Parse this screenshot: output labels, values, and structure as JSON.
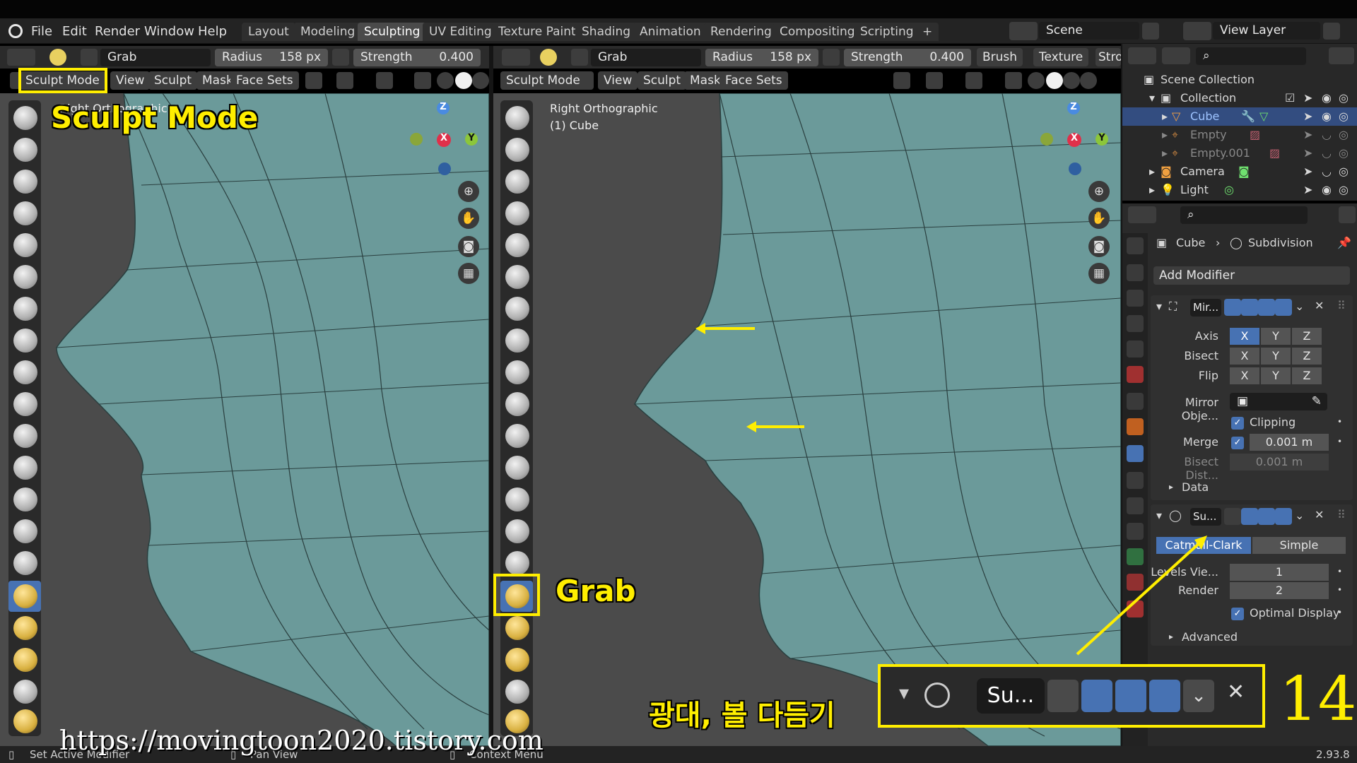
{
  "menu": {
    "file": "File",
    "edit": "Edit",
    "render": "Render",
    "window": "Window",
    "help": "Help"
  },
  "workspaces": [
    "Layout",
    "Modeling",
    "Sculpting",
    "UV Editing",
    "Texture Paint",
    "Shading",
    "Animation",
    "Rendering",
    "Compositing",
    "Scripting"
  ],
  "workspace_add": "+",
  "scene": "Scene",
  "view_layer": "View Layer",
  "left_view": {
    "brush_name": "Grab",
    "radius_label": "Radius",
    "radius_value": "158 px",
    "strength_label": "Strength",
    "strength_value": "0.400",
    "mode": "Sculpt Mode",
    "menus": [
      "View",
      "Sculpt",
      "Mask",
      "Face Sets"
    ],
    "view_title": "Right Orthographic"
  },
  "right_view": {
    "brush_name": "Grab",
    "radius_label": "Radius",
    "radius_value": "158 px",
    "strength_label": "Strength",
    "strength_value": "0.400",
    "brush_menu": "Brush",
    "texture_menu": "Texture",
    "stroke_menu": "Stro",
    "mode": "Sculpt Mode",
    "menus": [
      "View",
      "Sculpt",
      "Mask",
      "Face Sets"
    ],
    "view_title": "Right Orthographic",
    "view_object": "(1) Cube"
  },
  "gizmo": {
    "z": "Z",
    "x": "X",
    "y": "Y"
  },
  "outliner": {
    "scene_collection": "Scene Collection",
    "collection": "Collection",
    "items": [
      "Cube",
      "Empty",
      "Empty.001",
      "Camera",
      "Light"
    ]
  },
  "properties": {
    "object": "Cube",
    "modifier_name": "Subdivision",
    "add_modifier": "Add Modifier",
    "mirror": {
      "name": "Mir...",
      "axis_label": "Axis",
      "bisect_label": "Bisect",
      "flip_label": "Flip",
      "x": "X",
      "y": "Y",
      "z": "Z",
      "mirror_object_label": "Mirror Obje...",
      "clipping_label": "Clipping",
      "merge_label": "Merge",
      "merge_value": "0.001 m",
      "bisect_dist_label": "Bisect Dist...",
      "bisect_dist_value": "0.001 m",
      "data_label": "Data"
    },
    "subdiv": {
      "name": "Su...",
      "catmull": "Catmull-Clark",
      "simple": "Simple",
      "levels_label": "Levels Vie...",
      "levels_value": "1",
      "render_label": "Render",
      "render_value": "2",
      "optimal_label": "Optimal Display",
      "advanced_label": "Advanced"
    }
  },
  "status": {
    "left": "Set Active Modifier",
    "mid": "Pan View",
    "right": "Context Menu",
    "version": "2.93.8"
  },
  "overlay": {
    "sculpt_mode_caption": "Sculpt Mode",
    "grab_caption": "Grab",
    "korean_caption": "광대, 볼 다듬기",
    "zoom_name": "Su...",
    "page_number": "14",
    "url": "https://movingtoon2020.tistory.com"
  },
  "colors": {
    "accent": "#4772b3",
    "highlight": "#ffee00",
    "mesh": "#6b9a9a"
  }
}
